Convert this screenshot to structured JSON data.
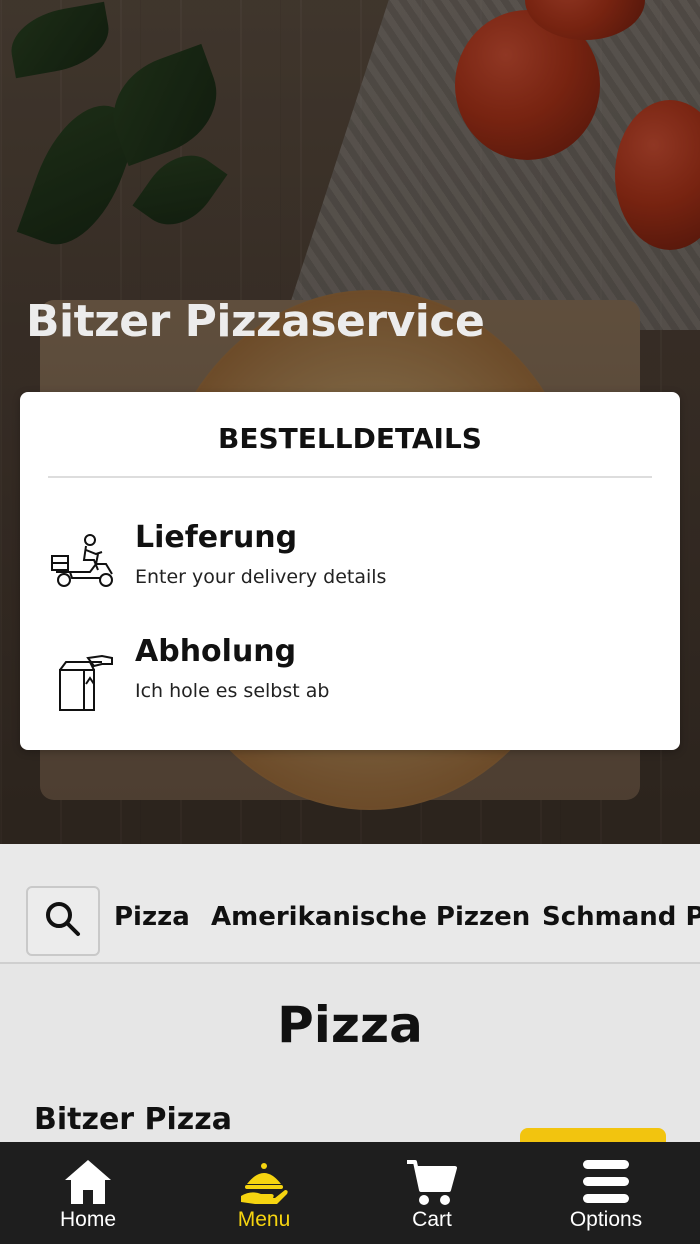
{
  "hero": {
    "restaurant_name": "Bitzer Pizzaservice"
  },
  "order_details": {
    "title": "BESTELLDETAILS",
    "options": [
      {
        "label": "Lieferung",
        "subtitle": "Enter your delivery details",
        "icon": "delivery-scooter-icon"
      },
      {
        "label": "Abholung",
        "subtitle": "Ich hole es selbst ab",
        "icon": "pickup-bag-icon"
      }
    ]
  },
  "categories": {
    "search_icon": "search-icon",
    "items": [
      "Pizza",
      "Amerikanische Pizzen",
      "Schmand P"
    ]
  },
  "menu": {
    "section_title": "Pizza",
    "items": [
      {
        "name": "Bitzer Pizza"
      }
    ]
  },
  "bottom_nav": {
    "items": [
      {
        "label": "Home",
        "icon": "home-icon",
        "active": false
      },
      {
        "label": "Menu",
        "icon": "cloche-icon",
        "active": true
      },
      {
        "label": "Cart",
        "icon": "cart-icon",
        "active": false
      },
      {
        "label": "Options",
        "icon": "menu-icon",
        "active": false
      }
    ]
  },
  "colors": {
    "accent": "#f5d410",
    "button_yellow": "#f2c40f",
    "nav_background": "#1e1e1e",
    "card_background": "#ffffff"
  }
}
